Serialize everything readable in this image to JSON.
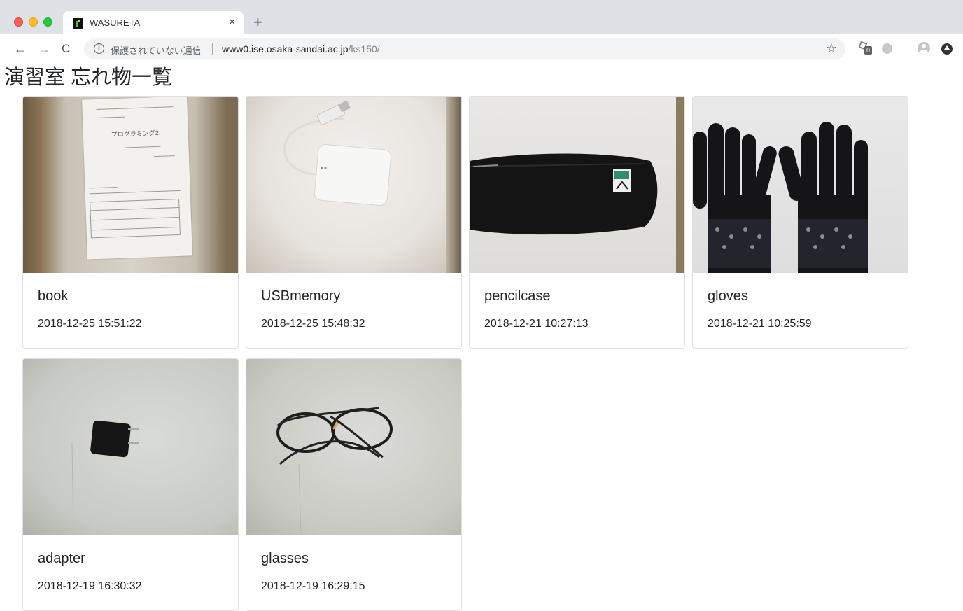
{
  "browser": {
    "tab_title": "WASURETA",
    "tab_close": "×",
    "new_tab": "+",
    "security_label": "保護されていない通信",
    "url_host": "www0.ise.osaka-sandai.ac.jp",
    "url_path": "/ks150/",
    "extension_badge": "0",
    "icons": [
      "back-arrow-icon",
      "forward-arrow-icon",
      "reload-icon",
      "info-icon",
      "star-icon",
      "extension-icon",
      "profile-icon",
      "menu-icon"
    ]
  },
  "page": {
    "title": "演習室 忘れ物一覧"
  },
  "items": [
    {
      "name": "book",
      "date": "2018-12-25 15:51:22"
    },
    {
      "name": "USBmemory",
      "date": "2018-12-25 15:48:32"
    },
    {
      "name": "pencilcase",
      "date": "2018-12-21 10:27:13"
    },
    {
      "name": "gloves",
      "date": "2018-12-21 10:25:59"
    },
    {
      "name": "adapter",
      "date": "2018-12-19 16:30:32"
    },
    {
      "name": "glasses",
      "date": "2018-12-19 16:29:15"
    }
  ],
  "paper_text": {
    "heading": "プログラミング2"
  }
}
